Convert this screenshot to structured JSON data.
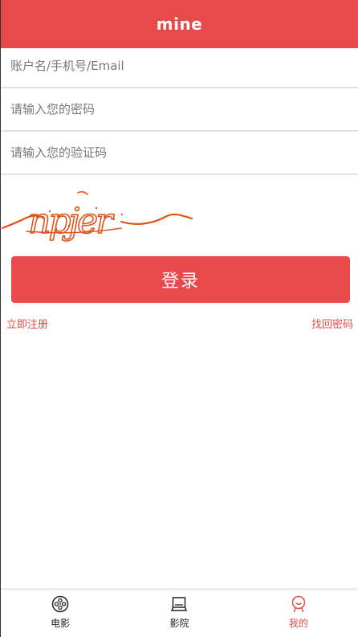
{
  "header": {
    "title": "mine"
  },
  "form": {
    "account_placeholder": "账户名/手机号/Email",
    "password_placeholder": "请输入您的密码",
    "captcha_placeholder": "请输入您的验证码",
    "captcha_text": "npjer"
  },
  "actions": {
    "login_label": "登录",
    "register_label": "立即注册",
    "forgot_label": "找回密码"
  },
  "tabbar": {
    "items": [
      {
        "label": "电影",
        "icon": "film-reel-icon",
        "active": false
      },
      {
        "label": "影院",
        "icon": "cinema-icon",
        "active": false
      },
      {
        "label": "我的",
        "icon": "user-icon",
        "active": true
      }
    ]
  },
  "colors": {
    "accent": "#e8494a",
    "captcha": "#e0541a"
  }
}
